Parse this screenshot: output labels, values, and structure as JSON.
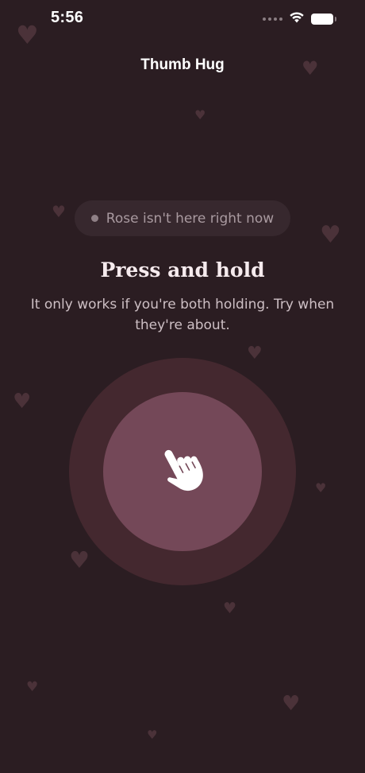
{
  "status_bar": {
    "time": "5:56"
  },
  "header": {
    "title": "Thumb Hug"
  },
  "presence": {
    "text": "Rose isn't here right now"
  },
  "prompt": {
    "heading": "Press and hold",
    "subtext": "It only works if you're both holding. Try when they're about."
  },
  "hold_button": {
    "icon": "pointing-hand-icon"
  },
  "colors": {
    "background": "#2b1d22",
    "pill": "#37282e",
    "outer_ring": "#44282f",
    "inner_circle": "#744858",
    "heart": "#4b3239"
  }
}
